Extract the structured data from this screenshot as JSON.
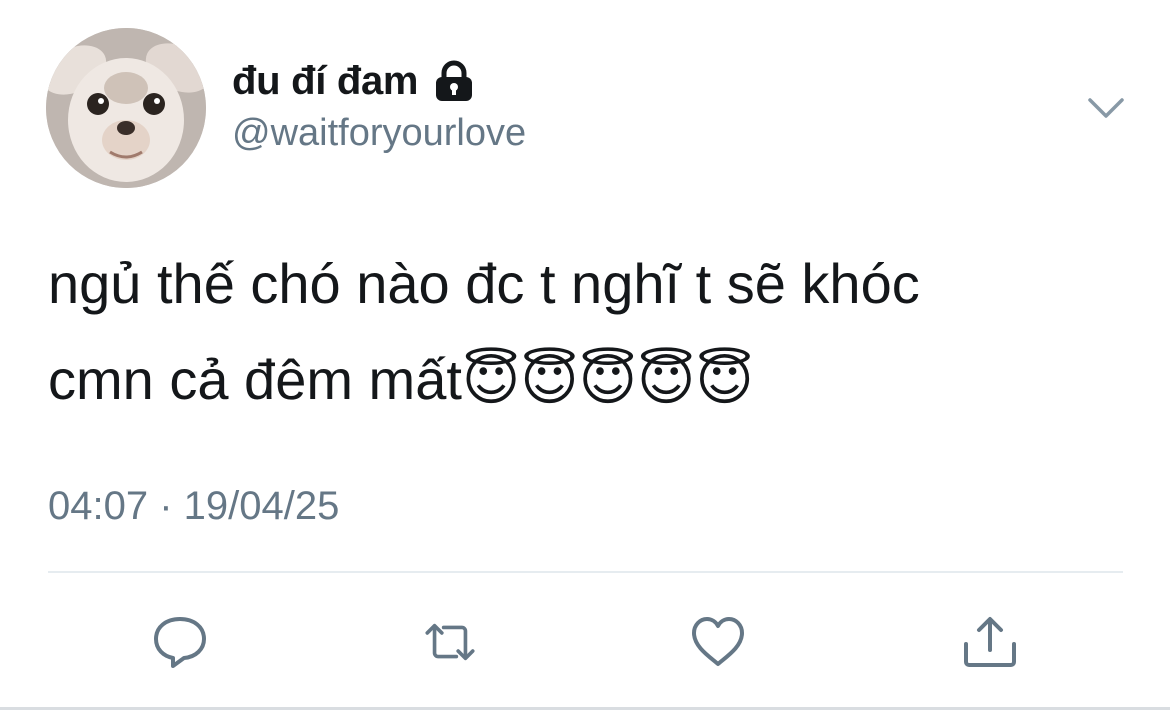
{
  "user": {
    "display_name": "đu đí đam",
    "handle": "@waitforyourlove",
    "avatar_icon": "chihuahua-avatar",
    "protected_icon": "lock-icon"
  },
  "tweet": {
    "text": "ngủ thế chó nào đc t nghĩ t sẽ khóc\ncmn cả đêm mất😇😇😇😇😇",
    "timestamp": "04:07 · 19/04/25"
  },
  "actions": [
    {
      "name": "reply",
      "icon": "speech-bubble-icon"
    },
    {
      "name": "retweet",
      "icon": "retweet-arrows-icon"
    },
    {
      "name": "like",
      "icon": "heart-icon"
    },
    {
      "name": "share",
      "icon": "share-upload-icon"
    }
  ],
  "menu": {
    "icon": "chevron-down-icon"
  },
  "colors": {
    "primary_text": "#14171a",
    "secondary_text": "#657786",
    "icon": "#657786",
    "divider": "#e6ecf0"
  }
}
